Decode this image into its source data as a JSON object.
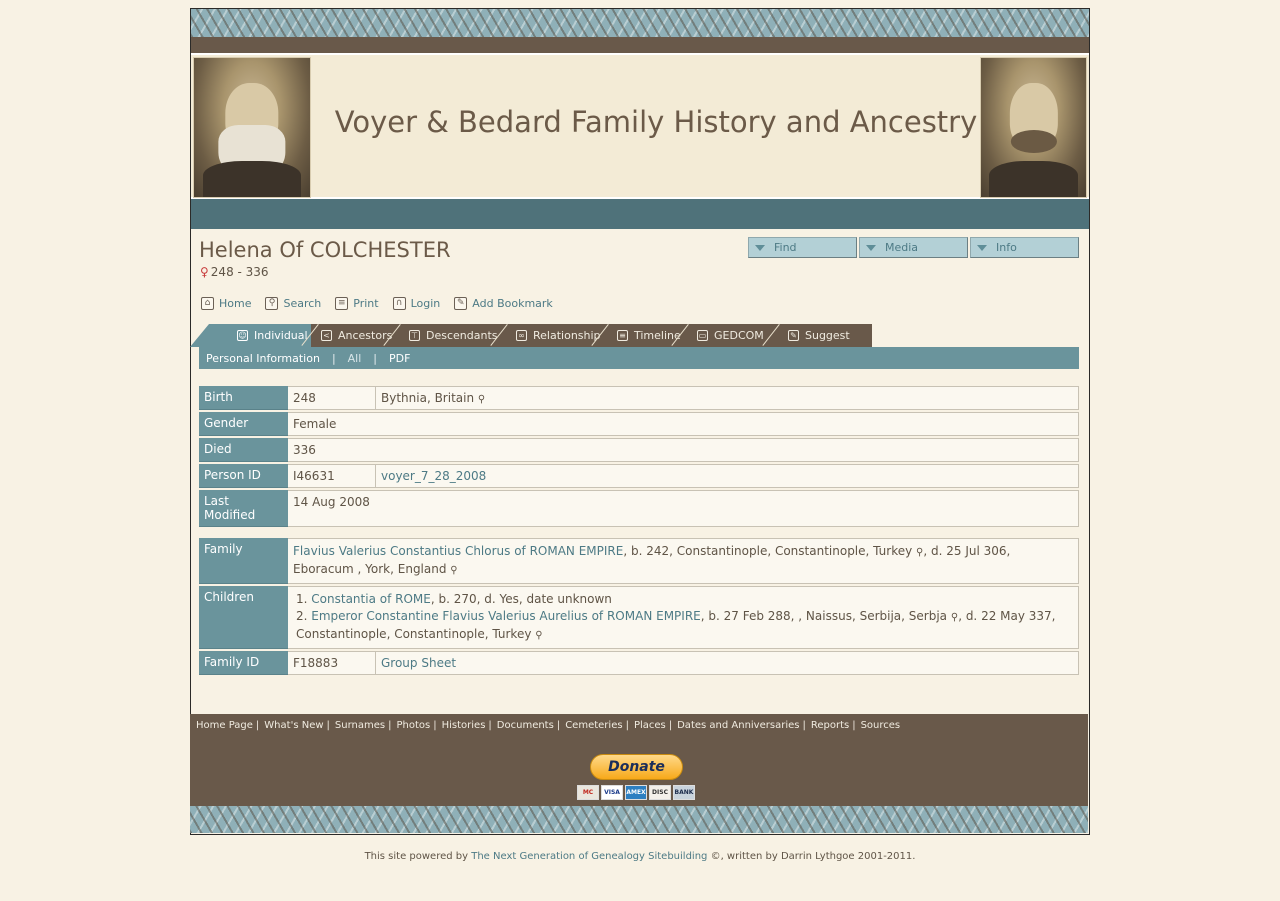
{
  "site": {
    "title": "Voyer & Bedard Family History and Ancestry"
  },
  "person": {
    "name": "Helena Of COLCHESTER",
    "gender_symbol": "♀",
    "dates": "248 - 336"
  },
  "menus": [
    "Find",
    "Media",
    "Info"
  ],
  "quicklinks": [
    {
      "label": "Home",
      "icon": "home-icon"
    },
    {
      "label": "Search",
      "icon": "search-icon"
    },
    {
      "label": "Print",
      "icon": "print-icon"
    },
    {
      "label": "Login",
      "icon": "lock-icon"
    },
    {
      "label": "Add Bookmark",
      "icon": "bookmark-icon"
    }
  ],
  "tabs": [
    {
      "label": "Individual",
      "icon": "person-icon",
      "active": true
    },
    {
      "label": "Ancestors",
      "icon": "ancestors-icon"
    },
    {
      "label": "Descendants",
      "icon": "descendants-icon"
    },
    {
      "label": "Relationship",
      "icon": "relationship-icon"
    },
    {
      "label": "Timeline",
      "icon": "timeline-icon"
    },
    {
      "label": "GEDCOM",
      "icon": "gedcom-icon"
    },
    {
      "label": "Suggest",
      "icon": "suggest-icon"
    }
  ],
  "subnav": {
    "personal": "Personal Information",
    "all": "All",
    "pdf": "PDF",
    "separator": "|"
  },
  "facts": {
    "birth_label": "Birth",
    "birth_date": "248",
    "birth_place": "Bythnia, Britain",
    "gender_label": "Gender",
    "gender_value": "Female",
    "died_label": "Died",
    "died_date": "336",
    "person_id_label": "Person ID",
    "person_id": "I46631",
    "tree": "voyer_7_28_2008",
    "modified_label": "Last Modified",
    "modified": "14 Aug 2008"
  },
  "family": {
    "family_label": "Family",
    "spouse": "Flavius Valerius Constantius Chlorus of ROMAN EMPIRE",
    "spouse_birth": ",   b. 242, Constantinople, Constantinople, Turkey",
    "spouse_death": ",   d. 25 Jul 306, Eboracum , York, England",
    "children_label": "Children",
    "child1_num": "1.",
    "child1_name": "Constantia of ROME",
    "child1_info": ",   b. 270,   d. Yes, date unknown",
    "child2_num": "2.",
    "child2_name": "Emperor Constantine Flavius Valerius Aurelius of ROMAN EMPIRE",
    "child2_birth": ",   b. 27 Feb 288, , Naissus, Serbija, Serbja",
    "child2_death": ",   d. 22 May 337, Constantinople, Constantinople, Turkey",
    "family_id_label": "Family ID",
    "family_id": "F18883",
    "group_sheet": "Group Sheet"
  },
  "footer": {
    "links": [
      "Home Page",
      "What's New",
      "Surnames",
      "Photos",
      "Histories",
      "Documents",
      "Cemeteries",
      "Places",
      "Dates and Anniversaries",
      "Reports",
      "Sources"
    ],
    "donate": "Donate",
    "cards": [
      "MC",
      "VISA",
      "AMEX",
      "DISC",
      "BANK"
    ]
  },
  "powered": {
    "prefix": "This site powered by ",
    "link": "The Next Generation of Genealogy Sitebuilding",
    "suffix": " ©, written by Darrin Lythgoe 2001-2011."
  },
  "colors": {
    "background": "#f8f2e4",
    "teal": "#6a949c",
    "brown": "#69594a",
    "link": "#4d7a85"
  }
}
